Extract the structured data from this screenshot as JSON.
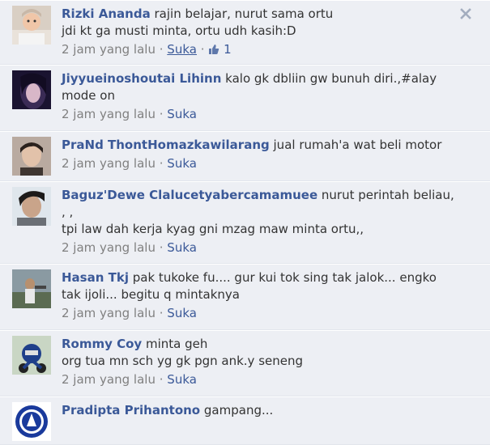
{
  "comments": [
    {
      "author": "Rizki Ananda",
      "text_line1": "rajin belajar, nurut sama ortu",
      "text_line2": "jdi kt ga musti minta, ortu udh kasih:D",
      "time": "2 jam yang lalu",
      "sep": "·",
      "like": "Suka",
      "like_count": "1"
    },
    {
      "author": "Jiyyueinoshoutai Lihinn",
      "text_line1": "kalo gk dbliin gw bunuh diri.,#alay",
      "text_line2": "mode on",
      "time": "2 jam yang lalu",
      "sep": "·",
      "like": "Suka"
    },
    {
      "author": "PraNd ThontHomazkawilarang",
      "text_line1": "jual rumah'a wat beli motor",
      "time": "2 jam yang lalu",
      "sep": "·",
      "like": "Suka"
    },
    {
      "author": "Baguz'Dewe Clalucetyabercamamuee",
      "text_line1": "nurut perintah beliau,",
      "text_line2": ", ,",
      "text_line3": "tpi law dah kerja kyag gni mzag maw minta ortu,,",
      "time": "2 jam yang lalu",
      "sep": "·",
      "like": "Suka"
    },
    {
      "author": "Hasan Tkj",
      "text_line1": "pak tukoke fu.... gur kui tok sing tak jalok... engko",
      "text_line2": "tak ijoli... begitu q mintaknya",
      "time": "2 jam yang lalu",
      "sep": "·",
      "like": "Suka"
    },
    {
      "author": "Rommy Coy",
      "text_line1": "minta geh",
      "text_line2": "org tua mn sch yg gk pgn ank.y seneng",
      "time": "2 jam yang lalu",
      "sep": "·",
      "like": "Suka"
    },
    {
      "author": "Pradipta Prihantono",
      "text_line1": "gampang..."
    }
  ],
  "colors": {
    "background": "#edeff4",
    "link": "#3b5998",
    "meta": "#808080"
  },
  "icons": {
    "close": "close-icon",
    "like": "thumbs-up-icon"
  }
}
